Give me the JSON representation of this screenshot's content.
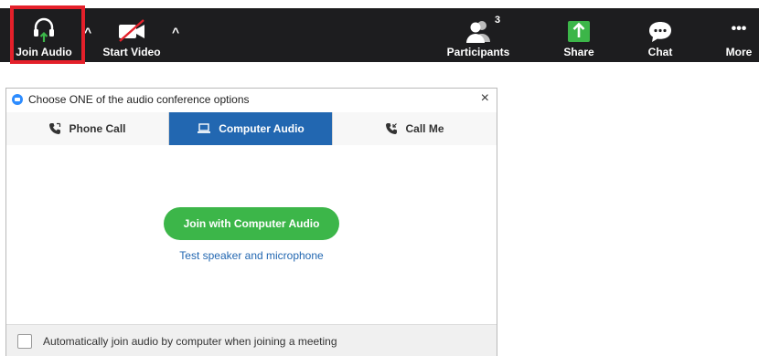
{
  "toolbar": {
    "join_audio": "Join Audio",
    "start_video": "Start Video",
    "participants": "Participants",
    "participants_count": "3",
    "share": "Share",
    "chat": "Chat",
    "more": "More",
    "caret": "^",
    "more_glyph": "•••"
  },
  "dialog": {
    "title": "Choose ONE of the audio conference options",
    "close": "×",
    "tabs": [
      {
        "label": "Phone Call",
        "icon": "phone-icon",
        "active": false
      },
      {
        "label": "Computer Audio",
        "icon": "laptop-icon",
        "active": true
      },
      {
        "label": "Call Me",
        "icon": "phone-icon",
        "active": false
      }
    ],
    "join_button": "Join with Computer Audio",
    "test_link": "Test speaker and microphone",
    "auto_join_label": "Automatically join audio by computer when joining a meeting"
  },
  "colors": {
    "toolbar_bg": "#1d1d1f",
    "highlight": "#e4202a",
    "active_tab": "#2267b1",
    "join_button": "#3cb649",
    "share_icon": "#3cb649"
  }
}
